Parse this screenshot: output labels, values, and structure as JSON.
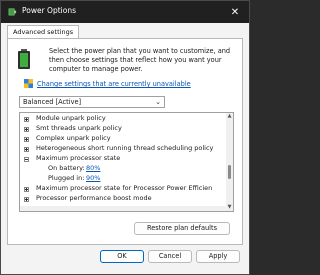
{
  "window": {
    "title": "Power Options",
    "close_glyph": "✕"
  },
  "tab": {
    "label": "Advanced settings"
  },
  "description": "Select the power plan that you want to customize, and then choose settings that reflect how you want your computer to manage power.",
  "change_link": "Change settings that are currently unavailable",
  "plan": {
    "selected": "Balanced [Active]"
  },
  "tree": {
    "rows": [
      {
        "label": "Module unpark policy",
        "state": "collapsed"
      },
      {
        "label": "Smt threads unpark policy",
        "state": "collapsed"
      },
      {
        "label": "Complex unpark policy",
        "state": "collapsed"
      },
      {
        "label": "Heterogeneous short running thread scheduling policy",
        "state": "collapsed"
      },
      {
        "label": "Maximum processor state",
        "state": "expanded"
      },
      {
        "label": "Maximum processor state for Processor Power Efficien",
        "state": "collapsed"
      },
      {
        "label": "Processor performance boost mode",
        "state": "collapsed"
      }
    ],
    "on_battery": {
      "label": "On battery:",
      "value": "80%"
    },
    "plugged_in": {
      "label": "Plugged in:",
      "value": "90%"
    }
  },
  "buttons": {
    "restore": "Restore plan defaults",
    "ok": "OK",
    "cancel": "Cancel",
    "apply": "Apply"
  },
  "colors": {
    "link": "#0b57b5",
    "titlebar": "#202020",
    "accent": "#0067c0"
  },
  "icons": [
    "power-options-icon",
    "battery-icon",
    "shield-icon",
    "close-icon",
    "chevron-down-icon"
  ]
}
